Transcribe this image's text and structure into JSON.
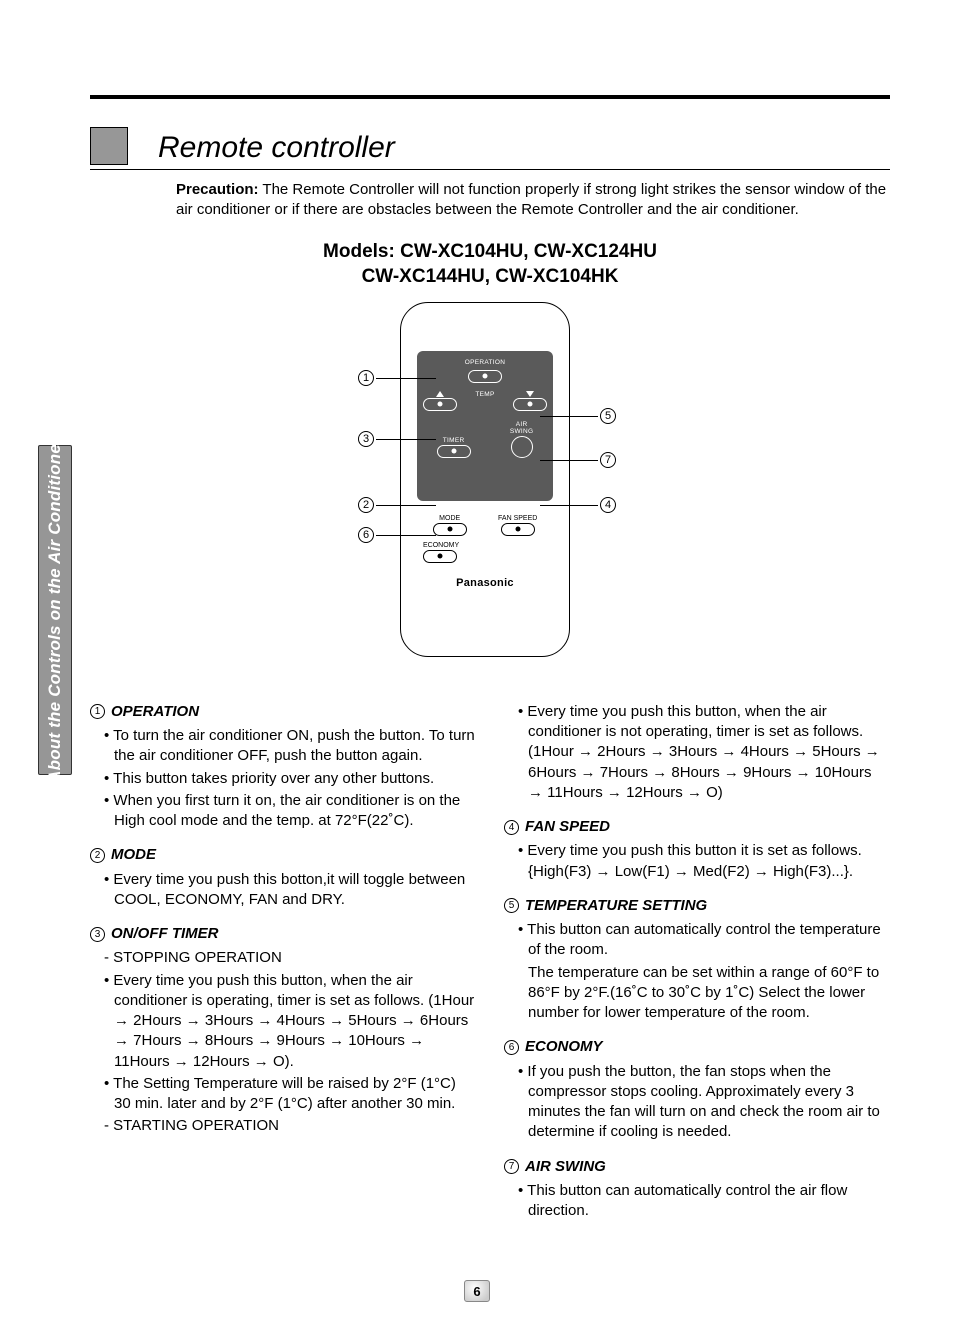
{
  "side_tab": "About the Controls on the Air Conditioner",
  "title": "Remote controller",
  "precaution_label": "Precaution:",
  "precaution_text": "The Remote Controller will not function properly if strong light strikes the sensor window of the air conditioner or if there are obstacles between the Remote Controller and the air conditioner.",
  "models_line1": "Models: CW-XC104HU, CW-XC124HU",
  "models_line2": "CW-XC144HU, CW-XC104HK",
  "remote": {
    "labels": {
      "operation": "OPERATION",
      "temp": "TEMP",
      "timer": "TIMER",
      "air_swing1": "AIR",
      "air_swing2": "SWING",
      "mode": "MODE",
      "fan_speed": "FAN SPEED",
      "economy": "ECONOMY"
    },
    "brand": "Panasonic",
    "callouts": {
      "c1": "1",
      "c2": "2",
      "c3": "3",
      "c4": "4",
      "c5": "5",
      "c6": "6",
      "c7": "7"
    }
  },
  "sections": {
    "s1": {
      "num": "1",
      "title": "OPERATION",
      "b1": "To turn the air conditioner ON, push the button. To turn the air conditioner OFF, push the button again.",
      "b2": "This button takes priority over any other buttons.",
      "b3": "When you first turn it on, the air conditioner is on the High cool mode and the temp. at 72°F(22˚C)."
    },
    "s2": {
      "num": "2",
      "title": "MODE",
      "b1": "Every time you push this botton,it will toggle between COOL, ECONOMY, FAN  and DRY."
    },
    "s3": {
      "num": "3",
      "title": "ON/OFF TIMER",
      "sub1": "- STOPPING OPERATION",
      "b1": "Every time you push this button,  when the air conditioner is operating, timer is set as follows. (1Hour → 2Hours → 3Hours → 4Hours → 5Hours → 6Hours → 7Hours → 8Hours → 9Hours → 10Hours → 11Hours → 12Hours → O).",
      "b2": "The Setting Temperature will be raised by 2°F (1°C) 30 min. later and by 2°F (1°C) after another 30 min.",
      "sub2": "- STARTING OPERATION",
      "b3": "Every time you push this button, when the air conditioner is not operating, timer is set as follows. (1Hour → 2Hours → 3Hours → 4Hours → 5Hours → 6Hours → 7Hours → 8Hours → 9Hours → 10Hours → 11Hours → 12Hours → O)"
    },
    "s4": {
      "num": "4",
      "title": "FAN SPEED",
      "b1": "Every time you push this button it is set as follows. {High(F3) → Low(F1) → Med(F2) → High(F3)...}."
    },
    "s5": {
      "num": "5",
      "title": "TEMPERATURE SETTING",
      "b1": "This button can automatically control the temperature of the room.",
      "t1": "The temperature can be set within a range of 60°F to 86°F by 2°F.(16˚C to 30˚C by 1˚C) Select the lower number for lower temperature of the room."
    },
    "s6": {
      "num": "6",
      "title": "ECONOMY",
      "b1": "If you push the button, the fan stops when the compressor stops cooling. Approximately every 3 minutes the fan will turn on and check the room air to determine if cooling is needed."
    },
    "s7": {
      "num": "7",
      "title": "AIR SWING",
      "b1": "This button can automatically control the air flow direction."
    }
  },
  "page_number": "6"
}
